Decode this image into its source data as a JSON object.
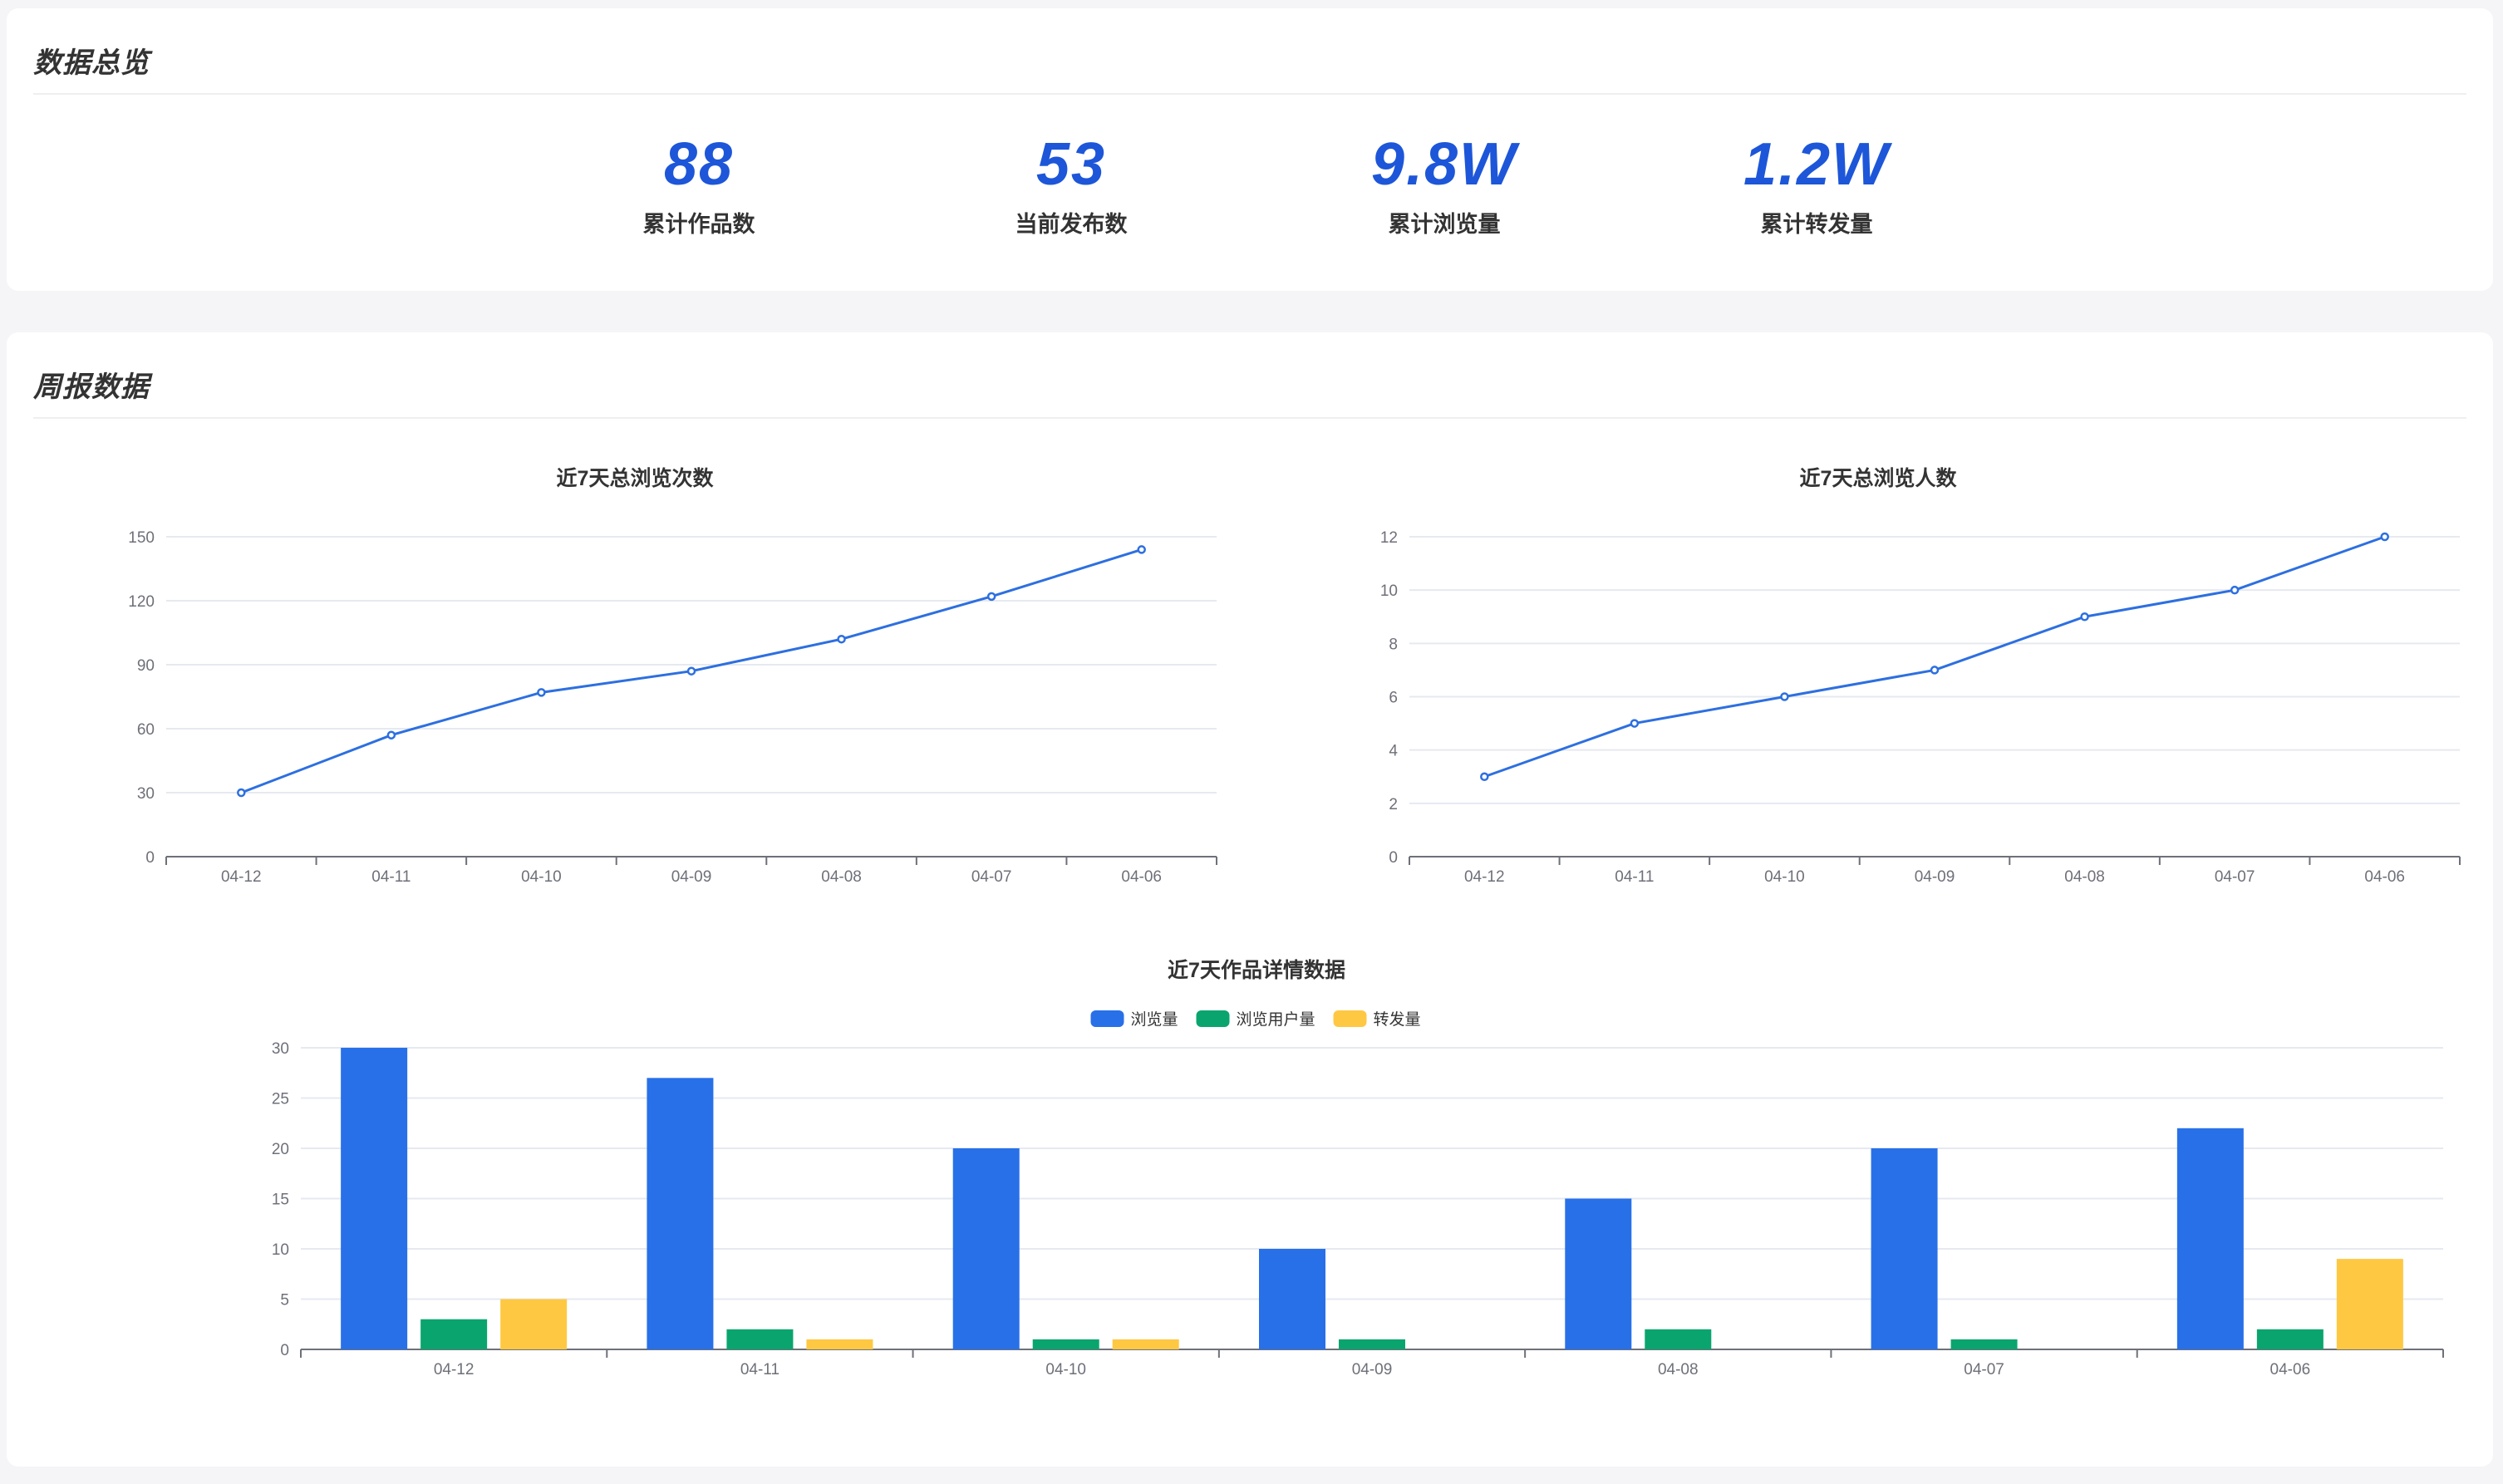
{
  "overview": {
    "title": "数据总览",
    "stats": [
      {
        "value": "88",
        "label": "累计作品数"
      },
      {
        "value": "53",
        "label": "当前发布数"
      },
      {
        "value": "9.8W",
        "label": "累计浏览量"
      },
      {
        "value": "1.2W",
        "label": "累计转发量"
      }
    ]
  },
  "weekly": {
    "title": "周报数据"
  },
  "colors": {
    "accent": "#1d56d8",
    "line": "#2d6fe0",
    "bar_views": "#2870e8",
    "bar_users": "#0aa56e",
    "bar_shares": "#ffc843"
  },
  "chart_data": [
    {
      "type": "line",
      "title": "近7天总浏览次数",
      "categories": [
        "04-12",
        "04-11",
        "04-10",
        "04-09",
        "04-08",
        "04-07",
        "04-06"
      ],
      "values": [
        30,
        57,
        77,
        87,
        102,
        122,
        144
      ],
      "ylim": [
        0,
        150
      ],
      "yticks": [
        0,
        30,
        60,
        90,
        120,
        150
      ],
      "grid": true
    },
    {
      "type": "line",
      "title": "近7天总浏览人数",
      "categories": [
        "04-12",
        "04-11",
        "04-10",
        "04-09",
        "04-08",
        "04-07",
        "04-06"
      ],
      "values": [
        3,
        5,
        6,
        7,
        9,
        10,
        12
      ],
      "ylim": [
        0,
        12
      ],
      "yticks": [
        0,
        2,
        4,
        6,
        8,
        10,
        12
      ],
      "grid": true
    },
    {
      "type": "bar",
      "title": "近7天作品详情数据",
      "categories": [
        "04-12",
        "04-11",
        "04-10",
        "04-09",
        "04-08",
        "04-07",
        "04-06"
      ],
      "series": [
        {
          "name": "浏览量",
          "values": [
            30,
            27,
            20,
            10,
            15,
            20,
            22
          ]
        },
        {
          "name": "浏览用户量",
          "values": [
            3,
            2,
            1,
            1,
            2,
            1,
            2
          ]
        },
        {
          "name": "转发量",
          "values": [
            5,
            1,
            1,
            0,
            0,
            0,
            9
          ]
        }
      ],
      "ylim": [
        0,
        30
      ],
      "yticks": [
        0,
        5,
        10,
        15,
        20,
        25,
        30
      ],
      "legend": "top-center",
      "grid": true
    }
  ]
}
